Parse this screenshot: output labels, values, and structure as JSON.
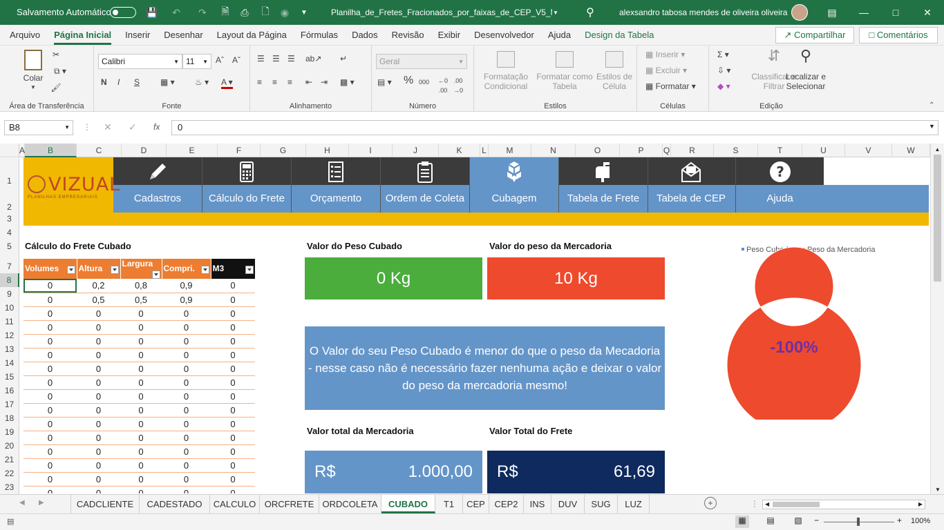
{
  "titlebar": {
    "autosave_label": "Salvamento Automático",
    "filename": "Planilha_de_Fretes_Fracionados_por_faixas_de_CEP_V5_M...",
    "user": "alexsandro tabosa mendes de oliveira oliveira"
  },
  "tabs": [
    "Arquivo",
    "Página Inicial",
    "Inserir",
    "Desenhar",
    "Layout da Página",
    "Fórmulas",
    "Dados",
    "Revisão",
    "Exibir",
    "Desenvolvedor",
    "Ajuda",
    "Design da Tabela"
  ],
  "share_label": "Compartilhar",
  "comments_label": "Comentários",
  "ribbon": {
    "clipboard": {
      "paste": "Colar",
      "group": "Área de Transferência"
    },
    "font": {
      "name": "Calibri",
      "size": "11",
      "group": "Fonte",
      "bold": "N",
      "italic": "I",
      "underline": "S"
    },
    "alignment": {
      "group": "Alinhamento"
    },
    "number": {
      "format": "Geral",
      "group": "Número"
    },
    "styles": {
      "cond": "Formatação Condicional",
      "table": "Formatar como Tabela",
      "cell": "Estilos de Célula",
      "group": "Estilos"
    },
    "cells": {
      "insert": "Inserir",
      "delete": "Excluir",
      "format": "Formatar",
      "group": "Células"
    },
    "editing": {
      "sort": "Classificar e Filtrar",
      "find": "Localizar e Selecionar",
      "group": "Edição"
    }
  },
  "formula_bar": {
    "namebox": "B8",
    "fx": "fx",
    "value": "0"
  },
  "columns": [
    "A",
    "B",
    "C",
    "D",
    "E",
    "F",
    "G",
    "H",
    "I",
    "J",
    "K",
    "L",
    "M",
    "N",
    "O",
    "P",
    "Q",
    "R",
    "S",
    "T",
    "U",
    "V",
    "W"
  ],
  "rows": [
    "1",
    "2",
    "3",
    "4",
    "5",
    "6",
    "7",
    "8",
    "9",
    "10",
    "11",
    "12",
    "13",
    "14",
    "15",
    "16",
    "17",
    "18",
    "19",
    "20",
    "21",
    "22",
    "23"
  ],
  "logo": {
    "brand": "VIZUAL",
    "tagline": "PLANILHAS EMPRESARIAIS"
  },
  "nav": [
    {
      "label": "Cadastros",
      "icon": "pencil-icon"
    },
    {
      "label": "Cálculo do Frete",
      "icon": "calculator-icon"
    },
    {
      "label": "Orçamento",
      "icon": "checklist-icon"
    },
    {
      "label": "Ordem de Coleta",
      "icon": "clipboard-icon"
    },
    {
      "label": "Cubagem",
      "icon": "boxes-icon"
    },
    {
      "label": "Tabela de Frete",
      "icon": "mailbox-icon"
    },
    {
      "label": "Tabela de CEP",
      "icon": "envelope-icon"
    },
    {
      "label": "Ajuda",
      "icon": "help-icon"
    }
  ],
  "cubagem": {
    "title": "Cálculo do Frete Cubado",
    "headers": [
      "Volumes",
      "Altura",
      "Largura",
      "Compri.",
      "M3"
    ],
    "rows": [
      [
        "0",
        "0,2",
        "0,8",
        "0,9",
        "0"
      ],
      [
        "0",
        "0,5",
        "0,5",
        "0,9",
        "0"
      ],
      [
        "0",
        "0",
        "0",
        "0",
        "0"
      ],
      [
        "0",
        "0",
        "0",
        "0",
        "0"
      ],
      [
        "0",
        "0",
        "0",
        "0",
        "0"
      ],
      [
        "0",
        "0",
        "0",
        "0",
        "0"
      ],
      [
        "0",
        "0",
        "0",
        "0",
        "0"
      ],
      [
        "0",
        "0",
        "0",
        "0",
        "0"
      ],
      [
        "0",
        "0",
        "0",
        "0",
        "0"
      ],
      [
        "0",
        "0",
        "0",
        "0",
        "0"
      ],
      [
        "0",
        "0",
        "0",
        "0",
        "0"
      ],
      [
        "0",
        "0",
        "0",
        "0",
        "0"
      ],
      [
        "0",
        "0",
        "0",
        "0",
        "0"
      ],
      [
        "0",
        "0",
        "0",
        "0",
        "0"
      ],
      [
        "0",
        "0",
        "0",
        "0",
        "0"
      ],
      [
        "0",
        "0",
        "0",
        "0",
        "0"
      ]
    ]
  },
  "peso_cubado": {
    "label": "Valor do Peso Cubado",
    "value": "0 Kg",
    "color": "#4aad3c"
  },
  "peso_mercadoria": {
    "label": "Valor do peso da Mercadoria",
    "value": "10 Kg",
    "color": "#ee4a2e"
  },
  "message": "O Valor do seu Peso Cubado é menor do que o peso da Mecadoria - nesse caso não é necessário fazer nenhuma ação e deixar o valor do peso da mercadoria mesmo!",
  "total_mercadoria": {
    "label": "Valor total da Mercadoria",
    "currency": "R$",
    "value": "1.000,00"
  },
  "total_frete": {
    "label": "Valor Total do Frete",
    "currency": "R$",
    "value": "61,69"
  },
  "chart_data": {
    "type": "pie",
    "donut": true,
    "categories": [
      "Peso Cubado",
      "Peso da Mercadoria"
    ],
    "values": [
      0,
      10
    ],
    "data_labels": [
      "0 Kg",
      "10 Kg"
    ],
    "colors": [
      "#5b8fd1",
      "#ee4a2e"
    ],
    "center_label": "-100%",
    "legend": "top"
  },
  "sheet_tabs": [
    "CADCLIENTE",
    "CADESTADO",
    "CALCULO",
    "ORCFRETE",
    "ORDCOLETA",
    "CUBADO",
    "T1",
    "CEP",
    "CEP2",
    "INS",
    "DUV",
    "SUG",
    "LUZ"
  ],
  "active_sheet": "CUBADO",
  "zoom": "100%"
}
